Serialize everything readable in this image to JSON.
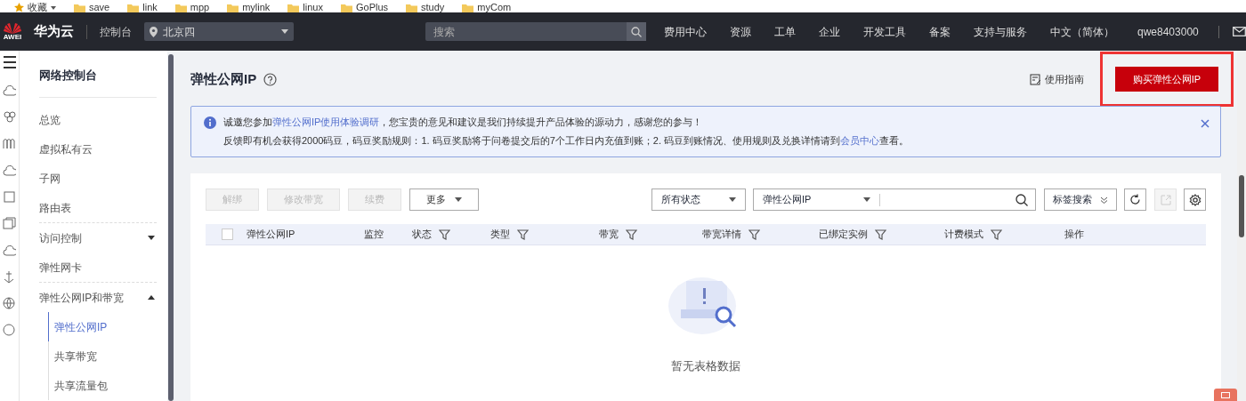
{
  "bookmarks": [
    {
      "label": "收藏",
      "kind": "star"
    },
    {
      "label": "save",
      "kind": "folder"
    },
    {
      "label": "link",
      "kind": "folder"
    },
    {
      "label": "mpp",
      "kind": "folder"
    },
    {
      "label": "mylink",
      "kind": "folder"
    },
    {
      "label": "linux",
      "kind": "folder"
    },
    {
      "label": "GoPlus",
      "kind": "folder"
    },
    {
      "label": "study",
      "kind": "folder"
    },
    {
      "label": "myCom",
      "kind": "folder"
    }
  ],
  "topbar": {
    "logo_text": "AWEI",
    "brand": "华为云",
    "console": "控制台",
    "region": "北京四",
    "search": {
      "placeholder": "搜索"
    },
    "menu": [
      "费用中心",
      "资源",
      "工单",
      "企业",
      "开发工具",
      "备案",
      "支持与服务",
      "中文（简体）",
      "qwe8403000"
    ]
  },
  "sidebar": {
    "title": "网络控制台",
    "items": [
      {
        "label": "总览",
        "selected": false
      },
      {
        "label": "虚拟私有云",
        "selected": false
      },
      {
        "label": "子网",
        "selected": false
      },
      {
        "label": "路由表",
        "selected": false,
        "divider": true
      },
      {
        "label": "访问控制",
        "selected": false,
        "expanded": false
      },
      {
        "label": "弹性网卡",
        "selected": false,
        "divider": true
      },
      {
        "label": "弹性公网IP和带宽",
        "selected": false,
        "expanded": true,
        "children": [
          {
            "label": "弹性公网IP",
            "selected": true
          },
          {
            "label": "共享带宽",
            "selected": false
          },
          {
            "label": "共享流量包",
            "selected": false
          }
        ]
      }
    ]
  },
  "page": {
    "title": "弹性公网IP",
    "guide": "使用指南",
    "buy_button": "购买弹性公网IP",
    "highlighted": true
  },
  "notice": {
    "lines": [
      [
        {
          "kind": "text",
          "text": "诚邀您参加"
        },
        {
          "kind": "link",
          "text": "弹性公网IP使用体验调研"
        },
        {
          "kind": "text",
          "text": "，您宝贵的意见和建议是我们持续提升产品体验的源动力，感谢您的参与！"
        }
      ],
      [
        {
          "kind": "text",
          "text": "反馈即有机会获得2000码豆，码豆奖励规则：1. 码豆奖励将于问卷提交后的7个工作日内充值到账；2. 码豆到账情况、使用规则及兑换详情请到"
        },
        {
          "kind": "link",
          "text": "会员中心"
        },
        {
          "kind": "text",
          "text": "查看。"
        }
      ]
    ]
  },
  "toolbar": {
    "buttons": [
      {
        "label": "解绑",
        "disabled": true
      },
      {
        "label": "修改带宽",
        "disabled": true
      },
      {
        "label": "续费",
        "disabled": true
      },
      {
        "label": "更多",
        "disabled": false
      }
    ],
    "status_filter": "所有状态",
    "search_field": "弹性公网IP",
    "tag_search": "标签搜索"
  },
  "table": {
    "select_all_checked": false,
    "columns": [
      {
        "label": "弹性公网IP",
        "filter": false
      },
      {
        "label": "监控",
        "filter": false
      },
      {
        "label": "状态",
        "filter": true
      },
      {
        "label": "类型",
        "filter": true
      },
      {
        "label": "带宽",
        "filter": true
      },
      {
        "label": "带宽详情",
        "filter": true
      },
      {
        "label": "已绑定实例",
        "filter": true
      },
      {
        "label": "计费模式",
        "filter": true
      },
      {
        "label": "操作",
        "filter": false
      }
    ],
    "empty_text": "暂无表格数据"
  }
}
